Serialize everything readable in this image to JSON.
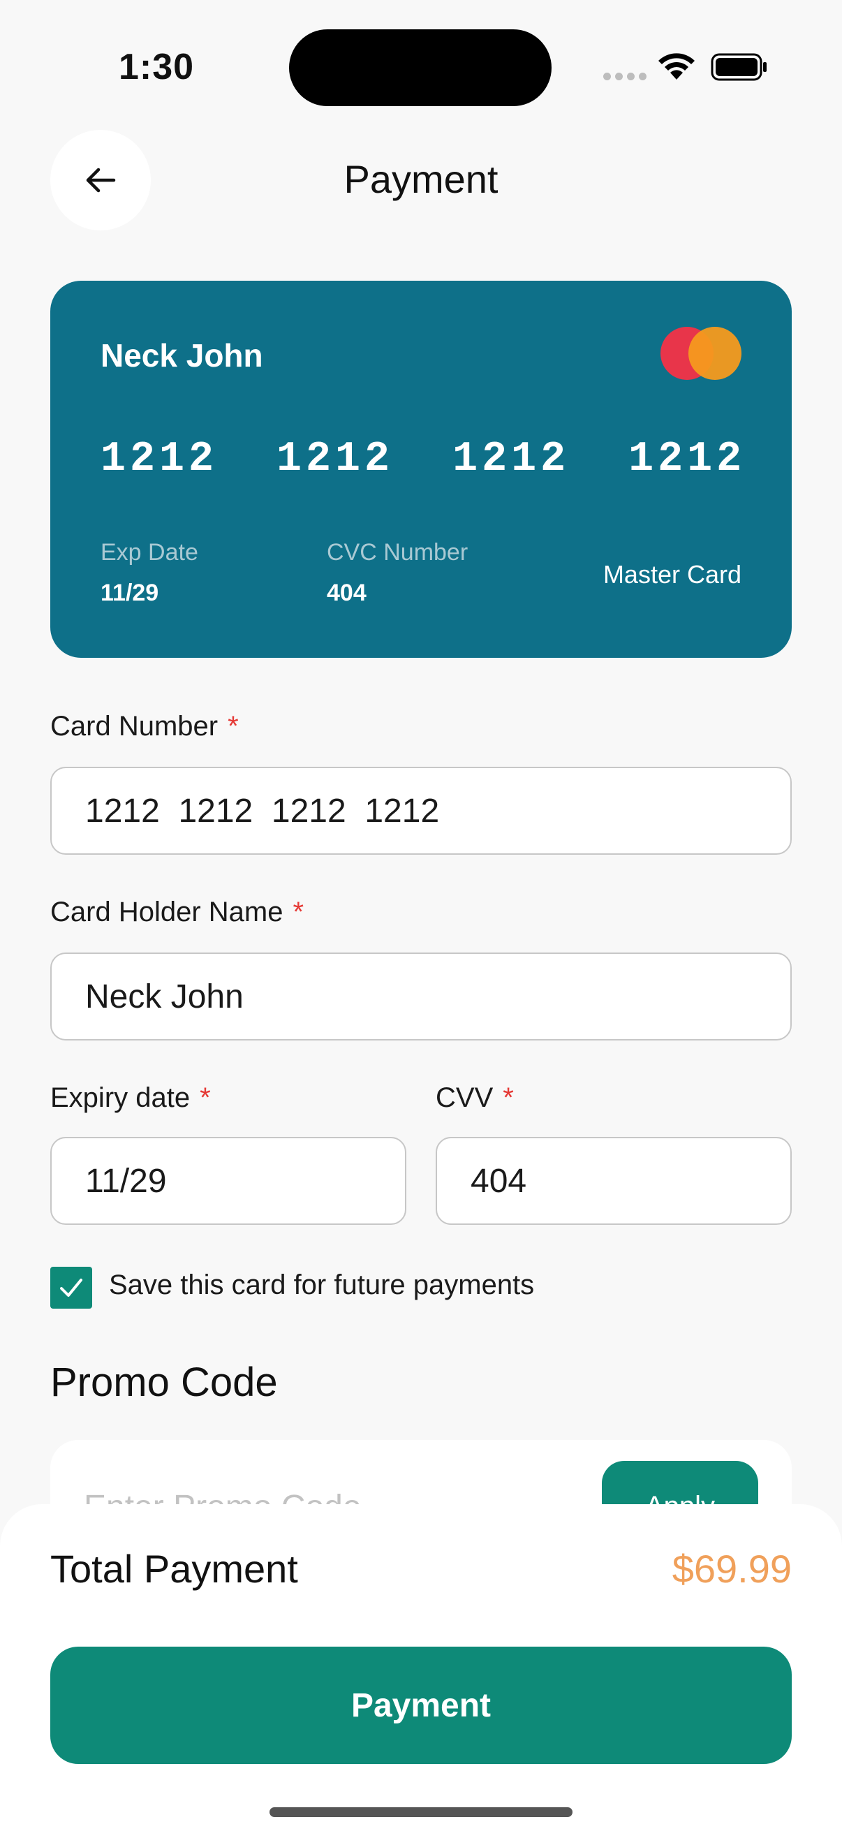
{
  "status_bar": {
    "time": "1:30"
  },
  "header": {
    "title": "Payment"
  },
  "card_preview": {
    "holder": "Neck John",
    "number": "1212  1212  1212  1212",
    "exp_label": "Exp Date",
    "exp_value": "11/29",
    "cvc_label": "CVC Number",
    "cvc_value": "404",
    "brand": "Master Card",
    "colors": {
      "card_bg": "#0e7089",
      "mc_red": "#e8354a",
      "mc_orange": "#f69a1e"
    }
  },
  "form": {
    "card_number": {
      "label": "Card Number",
      "required": "*",
      "value": "1212  1212  1212  1212"
    },
    "card_holder": {
      "label": "Card Holder Name",
      "required": "*",
      "value": "Neck John"
    },
    "expiry": {
      "label": "Expiry date",
      "required": "*",
      "value": "11/29"
    },
    "cvv": {
      "label": "CVV",
      "required": "*",
      "value": "404"
    },
    "save_card": {
      "label": "Save this card for future payments",
      "checked": true
    }
  },
  "promo": {
    "title": "Promo Code",
    "placeholder": "Enter Promo Code",
    "apply_label": "Apply"
  },
  "summary": {
    "total_label": "Total Payment",
    "total_amount": "$69.99",
    "pay_label": "Payment"
  },
  "colors": {
    "accent": "#0e8a78",
    "price": "#f0a05a",
    "required": "#e53935"
  },
  "icons": {
    "back": "arrow-left-icon",
    "check": "checkmark-icon",
    "wifi": "wifi-icon",
    "battery": "battery-icon"
  }
}
